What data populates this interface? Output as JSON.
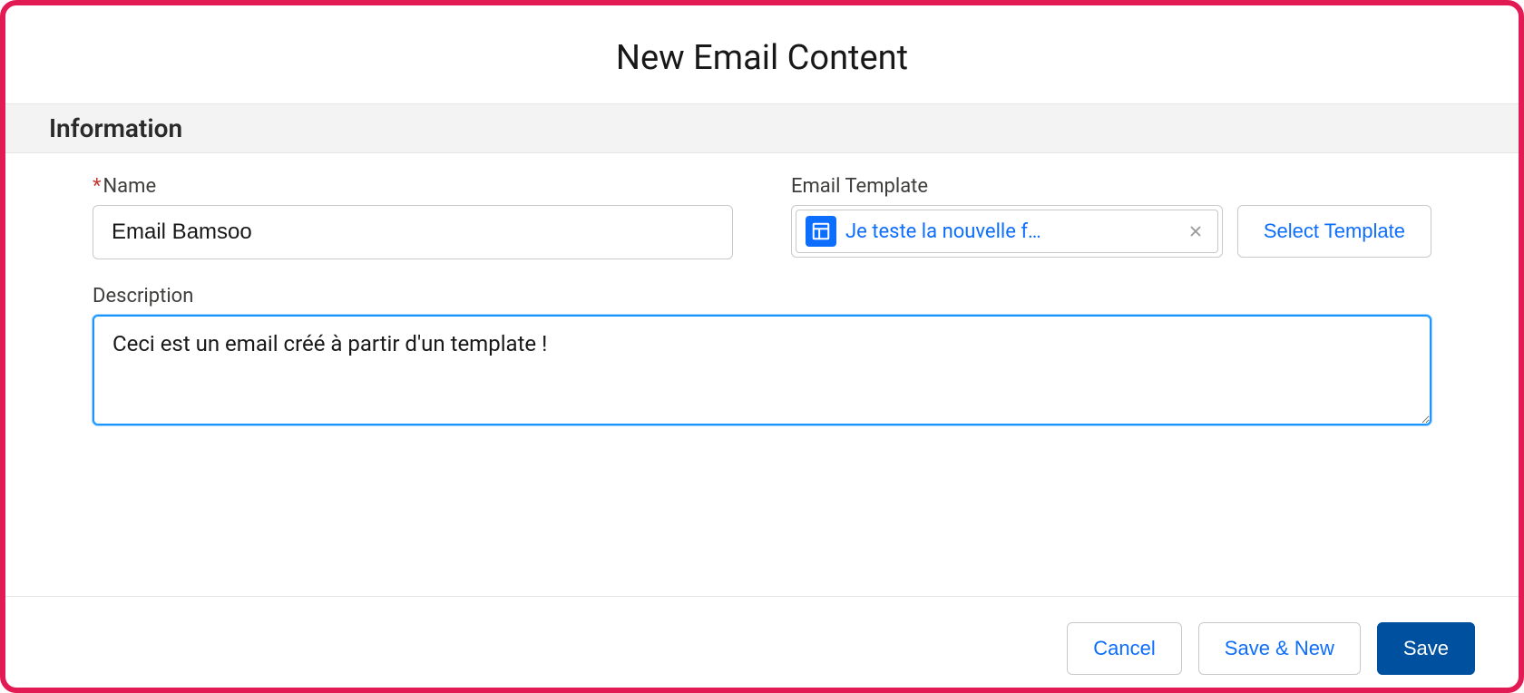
{
  "modal": {
    "title": "New Email Content"
  },
  "section": {
    "title": "Information"
  },
  "fields": {
    "name": {
      "label": "Name",
      "required_marker": "*",
      "value": "Email Bamsoo"
    },
    "template": {
      "label": "Email Template",
      "pill_text": "Je teste la nouvelle f…",
      "select_button": "Select Template"
    },
    "description": {
      "label": "Description",
      "value": "Ceci est un email créé à partir d'un template !"
    }
  },
  "footer": {
    "cancel": "Cancel",
    "save_new": "Save & New",
    "save": "Save"
  }
}
